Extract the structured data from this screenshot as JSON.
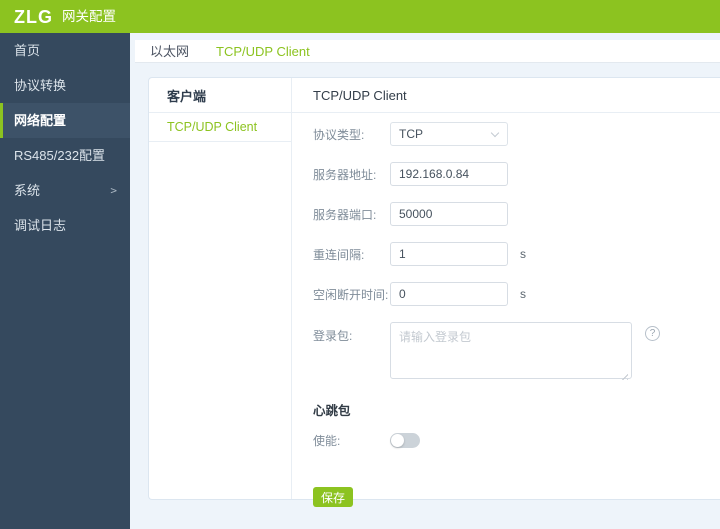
{
  "header": {
    "logo": "ZLG",
    "app_title": "网关配置"
  },
  "colors": {
    "brand_green": "#8cc320",
    "sidebar_bg": "#35495e",
    "sidebar_active_bg": "#3d5268",
    "page_bg": "#eef4fa",
    "toggle_off": "#ccd3d9"
  },
  "sidebar": {
    "items": [
      {
        "label": "首页"
      },
      {
        "label": "协议转换"
      },
      {
        "label": "网络配置"
      },
      {
        "label": "RS485/232配置"
      },
      {
        "label": "系统",
        "arrow": ">"
      },
      {
        "label": "调试日志"
      }
    ]
  },
  "tabs": {
    "ethernet": "以太网",
    "tcp_udp_client": "TCP/UDP Client"
  },
  "panel": {
    "client_header": "客户端",
    "client_item": "TCP/UDP Client",
    "content_title": "TCP/UDP Client",
    "form": {
      "protocol": {
        "label": "协议类型:",
        "value": "TCP"
      },
      "server_address": {
        "label": "服务器地址:",
        "value": "192.168.0.84"
      },
      "server_port": {
        "label": "服务器端口:",
        "value": "50000"
      },
      "reconnect_interval": {
        "label": "重连间隔:",
        "value": "1",
        "unit": "s"
      },
      "idle_disconnect": {
        "label": "空闲断开时间:",
        "value": "0",
        "unit": "s"
      },
      "login_packet": {
        "label": "登录包:",
        "placeholder": "请输入登录包",
        "help_icon": "?"
      },
      "heartbeat_section": "心跳包",
      "enable": {
        "label": "使能:",
        "state": "off"
      },
      "save_label": "保存"
    }
  }
}
